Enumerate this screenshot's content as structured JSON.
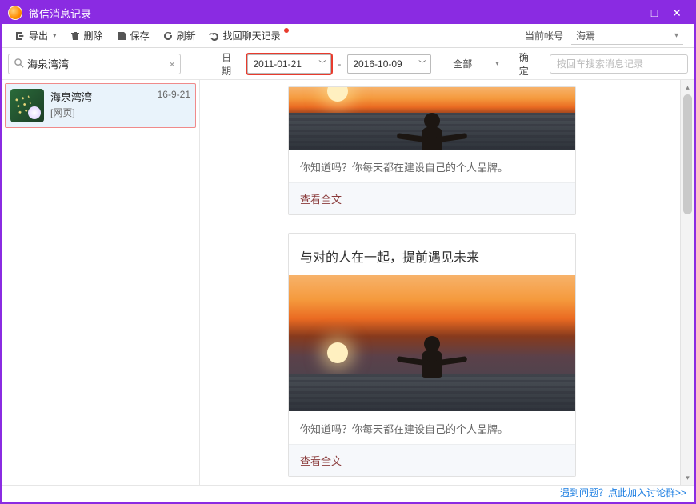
{
  "window": {
    "title": "微信消息记录"
  },
  "toolbar": {
    "export": "导出",
    "delete": "删除",
    "save": "保存",
    "refresh": "刷新",
    "findchat": "找回聊天记录",
    "account_label": "当前帐号",
    "account_value": "海焉"
  },
  "filter": {
    "search_value": "海泉湾湾",
    "date_label": "日期",
    "date_from": "2011-01-21",
    "date_to": "2016-10-09",
    "category": "全部",
    "confirm": "确定",
    "search_placeholder": "按回车搜索消息记录"
  },
  "sidebar": {
    "items": [
      {
        "name": "海泉湾湾",
        "tag": "[网页]",
        "date": "16-9-21"
      }
    ]
  },
  "chat": {
    "cards": [
      {
        "title": "",
        "desc": "你知道吗？你每天都在建设自己的个人品牌。",
        "read_more": "查看全文"
      },
      {
        "title": "与对的人在一起，提前遇见未来",
        "desc": "你知道吗？你每天都在建设自己的个人品牌。",
        "read_more": "查看全文"
      }
    ]
  },
  "footer": {
    "help_link": "遇到问题？点此加入讨论群>>"
  }
}
